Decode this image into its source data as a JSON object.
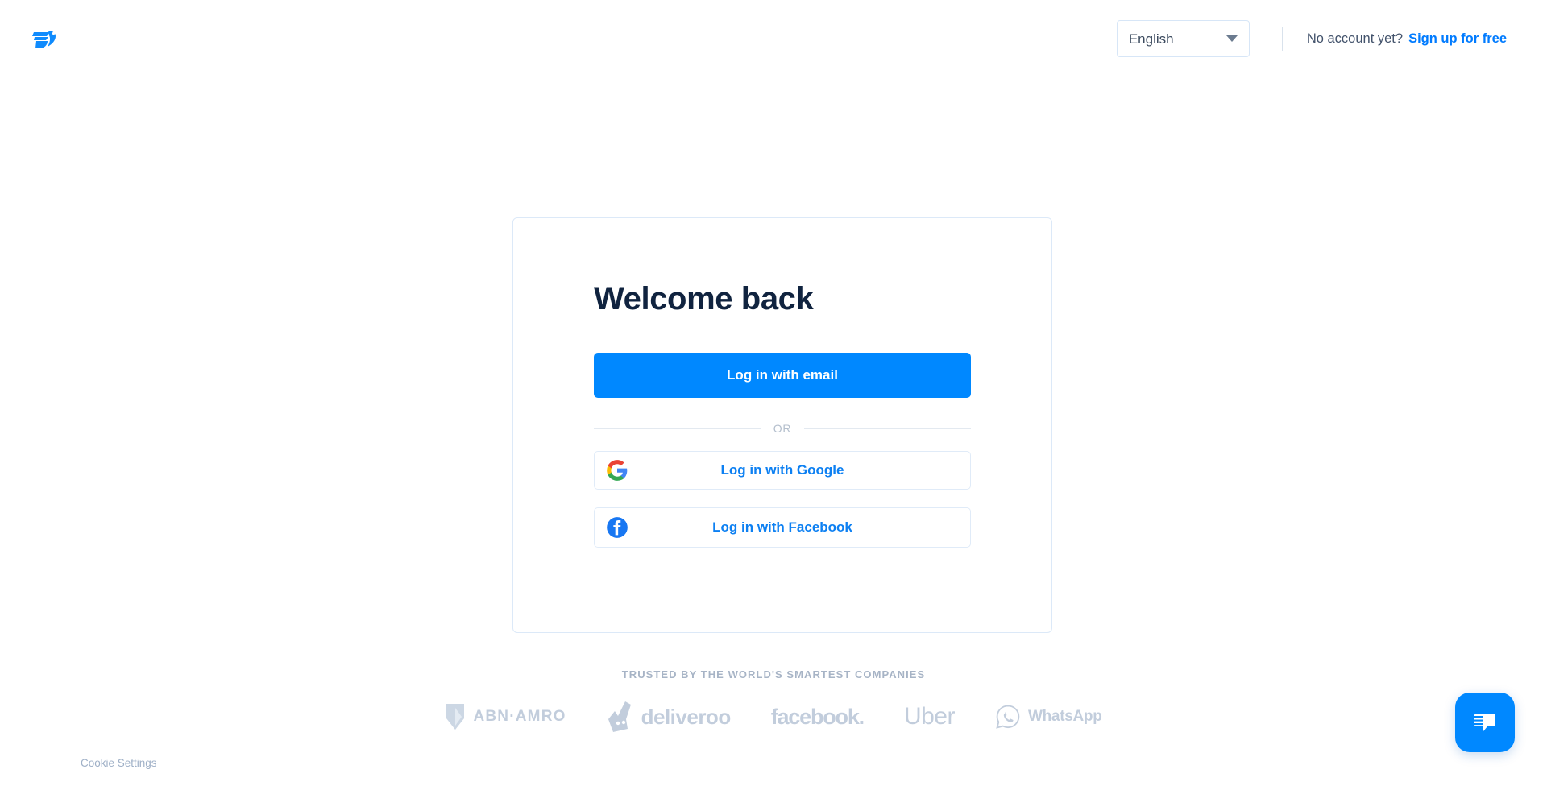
{
  "header": {
    "logo_icon": "front-bird-logo-icon",
    "language": {
      "selected": "English",
      "caret_icon": "chevron-down-icon"
    },
    "no_account_text": "No account yet?",
    "signup_label": "Sign up for free"
  },
  "card": {
    "title": "Welcome back",
    "email_button_label": "Log in with email",
    "divider_label": "OR",
    "google": {
      "icon": "google-icon",
      "label": "Log in with Google"
    },
    "facebook": {
      "icon": "facebook-icon",
      "label": "Log in with Facebook"
    }
  },
  "trusted": {
    "title": "TRUSTED BY THE WORLD'S SMARTEST COMPANIES",
    "logos": [
      {
        "name": "ABN·AMRO",
        "icon": "abn-amro-shield-icon"
      },
      {
        "name": "deliveroo",
        "icon": "deliveroo-kangaroo-icon"
      },
      {
        "name": "facebook.",
        "icon": ""
      },
      {
        "name": "Uber",
        "icon": ""
      },
      {
        "name": "WhatsApp",
        "icon": "whatsapp-phone-icon"
      }
    ]
  },
  "footer": {
    "cookie_settings_label": "Cookie Settings"
  },
  "chat": {
    "icon": "chat-bubble-icon"
  },
  "colors": {
    "accent_blue": "#0088ff",
    "link_blue": "#007bff",
    "heading_navy": "#10233f",
    "card_border": "#dce9f8",
    "muted_gray": "#c2cddc"
  }
}
